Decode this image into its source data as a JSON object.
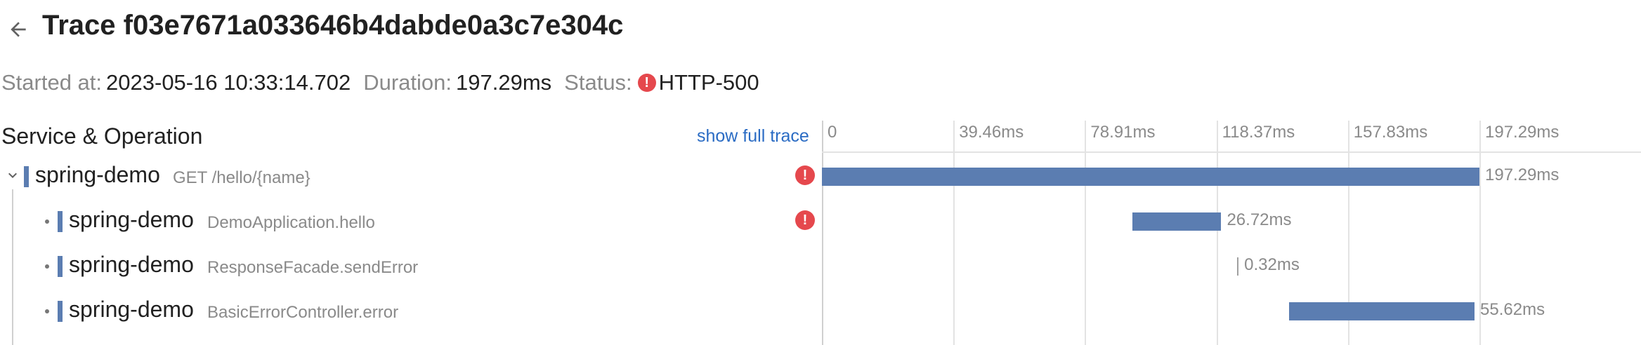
{
  "trace": {
    "title": "Trace f03e7671a033646b4dabde0a3c7e304c",
    "started_label": "Started at:",
    "started_value": "2023-05-16 10:33:14.702",
    "duration_label": "Duration:",
    "duration_value": "197.29ms",
    "status_label": "Status:",
    "status_value": "HTTP-500"
  },
  "table": {
    "column_header": "Service & Operation",
    "show_full_trace": "show full trace"
  },
  "axis": {
    "ticks": [
      "0",
      "39.46ms",
      "78.91ms",
      "118.37ms",
      "157.83ms",
      "197.29ms"
    ]
  },
  "spans": [
    {
      "service": "spring-demo",
      "operation": "GET /hello/{name}",
      "duration": "197.29ms",
      "error": true,
      "start_ms": 0,
      "duration_ms": 197.29
    },
    {
      "service": "spring-demo",
      "operation": "DemoApplication.hello",
      "duration": "26.72ms",
      "error": true,
      "start_ms": 93.1,
      "duration_ms": 26.72
    },
    {
      "service": "spring-demo",
      "operation": "ResponseFacade.sendError",
      "duration": "0.32ms",
      "error": false,
      "start_ms": 124.6,
      "duration_ms": 0.32
    },
    {
      "service": "spring-demo",
      "operation": "BasicErrorController.error",
      "duration": "55.62ms",
      "error": false,
      "start_ms": 140.2,
      "duration_ms": 55.62
    }
  ],
  "icons": {
    "back": "arrow-left-icon",
    "error": "error-icon",
    "expand": "chevron-down-icon"
  },
  "colors": {
    "span_bar": "#5b7db1",
    "error": "#e5484d",
    "link": "#2b6cc4"
  }
}
